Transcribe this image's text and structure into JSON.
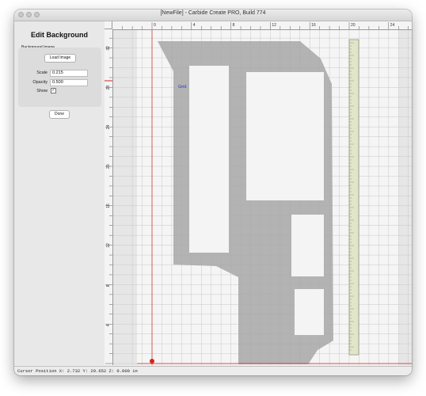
{
  "window": {
    "title": "[NewFile] - Carbide Create PRO, Build 774"
  },
  "panel": {
    "title": "Edit Background",
    "group_label": "Background Image",
    "load_button": "Load Image",
    "scale_label": "Scale",
    "scale_value": "0.215",
    "opacity_label": "Opacity",
    "opacity_value": "0.500",
    "show_label": "Show",
    "show_checked": true,
    "show_mark": "✓",
    "done_button": "Done"
  },
  "ruler": {
    "top_ticks": [
      "0",
      "4",
      "8",
      "12",
      "16",
      "20",
      "24"
    ],
    "left_ticks": [
      "32",
      "28",
      "24",
      "20",
      "16",
      "12",
      "8",
      "4"
    ]
  },
  "canvas": {
    "grid_label": "Grid",
    "accent_red": "#d0261f",
    "grid_color": "#c9c9c9",
    "shape_color": "#a5a5a5"
  },
  "status": {
    "text": "Cursor Position X: 2.732 Y: 29.652 Z: 0.000 in"
  }
}
